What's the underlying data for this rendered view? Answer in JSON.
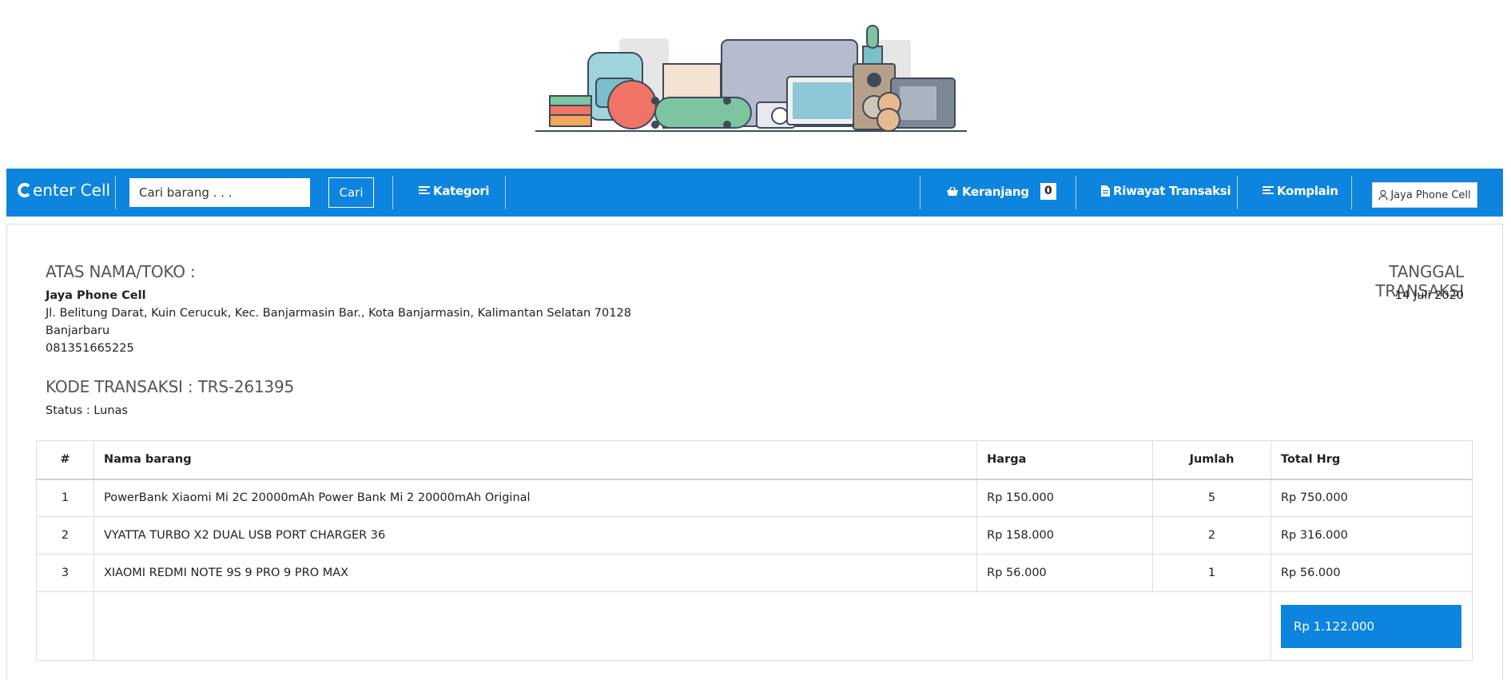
{
  "navbar": {
    "brand_rest": "enter Cell",
    "search_placeholder": "Cari barang . . .",
    "search_button": "Cari",
    "kategori": "Kategori",
    "keranjang": "Keranjang",
    "keranjang_count": "0",
    "riwayat": "Riwayat Transaksi",
    "komplain": "Komplain",
    "user": "Jaya Phone Cell"
  },
  "invoice": {
    "atas_nama_heading": "ATAS NAMA/TOKO :",
    "store_name": "Jaya Phone Cell",
    "address": "Jl. Belitung Darat, Kuin Cerucuk, Kec. Banjarmasin Bar., Kota Banjarmasin, Kalimantan Selatan 70128",
    "city": "Banjarbaru",
    "phone": "081351665225",
    "kode_transaksi": "KODE TRANSAKSI : TRS-261395",
    "status": "Status : Lunas",
    "tanggal_heading": "TANGGAL TRANSAKSI",
    "tanggal": "14 Juli 2020"
  },
  "table": {
    "headers": [
      "#",
      "Nama barang",
      "Harga",
      "Jumlah",
      "Total Hrg"
    ],
    "rows": [
      {
        "no": "1",
        "name": "PowerBank Xiaomi Mi 2C 20000mAh Power Bank Mi 2 20000mAh Original",
        "price": "Rp 150.000",
        "qty": "5",
        "total": "Rp 750.000"
      },
      {
        "no": "2",
        "name": "VYATTA TURBO X2 DUAL USB PORT CHARGER 36",
        "price": "Rp 158.000",
        "qty": "2",
        "total": "Rp 316.000"
      },
      {
        "no": "3",
        "name": "XIAOMI REDMI NOTE 9S 9 PRO 9 PRO MAX",
        "price": "Rp 56.000",
        "qty": "1",
        "total": "Rp 56.000"
      }
    ],
    "grand_total": "Rp 1.122.000"
  },
  "colors": {
    "primary": "#0d84de",
    "heading_gray": "#555555"
  }
}
